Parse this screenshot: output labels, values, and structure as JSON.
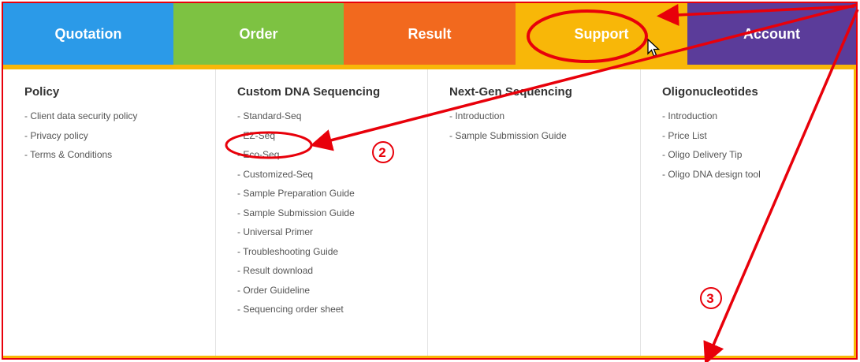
{
  "nav": {
    "tabs": [
      {
        "label": "Quotation",
        "color": "#2b9ae8"
      },
      {
        "label": "Order",
        "color": "#7dc242"
      },
      {
        "label": "Result",
        "color": "#f2691e"
      },
      {
        "label": "Support",
        "color": "#f8b708",
        "active": true
      },
      {
        "label": "Account",
        "color": "#5b3c9a"
      }
    ]
  },
  "menu": {
    "columns": [
      {
        "title": "Policy",
        "items": [
          "Client data security policy",
          "Privacy policy",
          "Terms & Conditions"
        ]
      },
      {
        "title": "Custom DNA Sequencing",
        "items": [
          "Standard-Seq",
          "EZ-Seq",
          "Eco-Seq",
          "Customized-Seq",
          "Sample Preparation Guide",
          "Sample Submission Guide",
          "Universal Primer",
          "Troubleshooting Guide",
          "Result download",
          "Order Guideline",
          "Sequencing order sheet"
        ]
      },
      {
        "title": "Next-Gen Sequencing",
        "items": [
          "Introduction",
          "Sample Submission Guide"
        ]
      },
      {
        "title": "Oligonucleotides",
        "items": [
          "Introduction",
          "Price List",
          "Oligo Delivery Tip",
          "Oligo DNA design tool"
        ]
      }
    ]
  },
  "annotations": {
    "marker_2": "2",
    "marker_3": "3",
    "color": "#e8000a"
  }
}
